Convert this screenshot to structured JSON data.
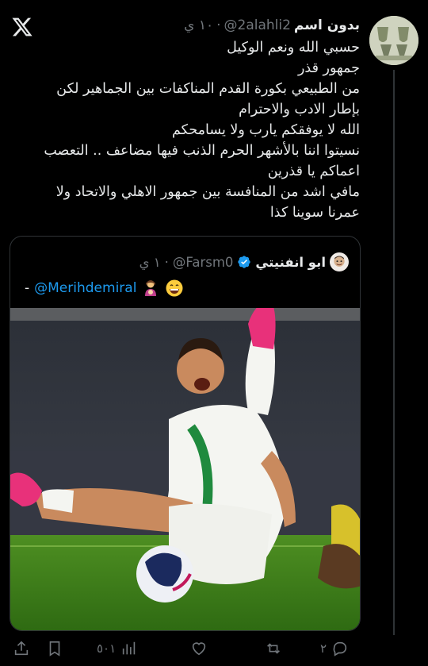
{
  "tweet": {
    "author_name": "بدون اسم",
    "author_handle": "@2alahli2",
    "time": "١٠ ي",
    "dot": "·",
    "lines": [
      "حسبي الله ونعم الوكيل",
      "جمهور قذر",
      "من الطبيعي بكورة القدم المناكفات بين الجماهير لكن",
      "بإطار الادب والاحترام",
      "الله لا يوفقكم يارب ولا يسامحكم",
      "نسيتوا اننا بالأشهر الحرم الذنب فيها مضاعف .. التعصب",
      "اعماكم يا قذرين",
      "مافي اشد من المنافسة بين جمهور الاهلي والاتحاد ولا",
      "عمرنا سوينا كذا"
    ]
  },
  "quote": {
    "author_name": "ابو انفنيتي",
    "author_handle": "@Farsm0",
    "time": "١ ي",
    "dot": "·",
    "mention": "@Merihdemiral",
    "dash": "-"
  },
  "actions": {
    "reply_count": "٢",
    "retweet_count": "",
    "like_count": "",
    "views_count": "٥٠١"
  },
  "icons": {
    "logo": "x-logo-icon",
    "verified": "verified-badge-icon",
    "reply": "reply-icon",
    "retweet": "retweet-icon",
    "like": "heart-icon",
    "views": "views-chart-icon",
    "bookmark": "bookmark-icon",
    "share": "share-icon"
  },
  "colors": {
    "background": "#000000",
    "text": "#e7e9ea",
    "secondary": "#71767b",
    "link": "#1d9bf0",
    "border": "#2f3336"
  }
}
